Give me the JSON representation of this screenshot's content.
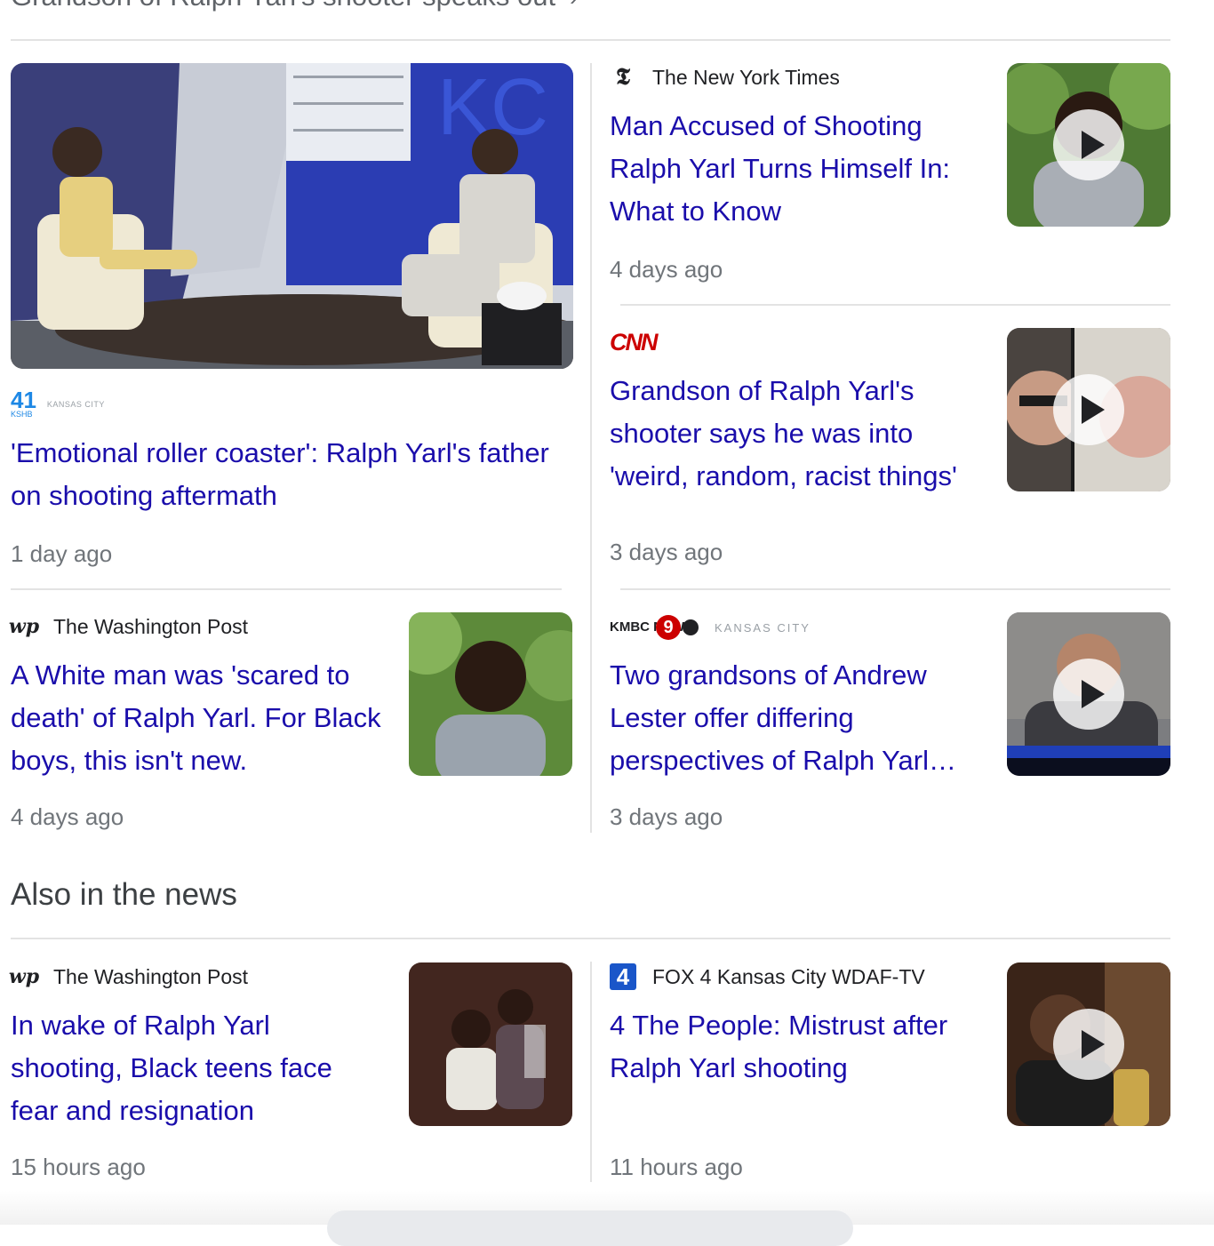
{
  "top_heading": {
    "text": "Grandson of Ralph Yarl's shooter speaks out",
    "chevron": "›"
  },
  "stories": [
    {
      "source_logo_text": "41",
      "source_logo_sub": "KSHB",
      "source_logo_city": "KANSAS CITY",
      "title": "'Emotional roller coaster': Ralph Yarl's father on shooting aftermath",
      "time": "1 day ago"
    },
    {
      "source": "The New York Times",
      "source_logo_text": "𝕿",
      "title": "Man Accused of Shooting Ralph Yarl Turns Himself In: What to Know",
      "time": "4 days ago"
    },
    {
      "source_logo_text": "CNN",
      "title": "Grandson of Ralph Yarl's shooter says he was into 'weird, random, racist things'",
      "time": "3 days ago"
    },
    {
      "source": "The Washington Post",
      "source_logo_text": "wp",
      "title": "A White man was 'scared to death' of Ralph Yarl. For Black boys, this isn't new.",
      "time": "4 days ago"
    },
    {
      "source_logo_text": "KMBC NEWS",
      "source_logo_badge": "9",
      "source_logo_city": "KANSAS CITY",
      "title": "Two grandsons of Andrew Lester offer differing perspectives of Ralph Yarl…",
      "time": "3 days ago"
    }
  ],
  "also_heading": "Also in the news",
  "also_stories": [
    {
      "source": "The Washington Post",
      "source_logo_text": "wp",
      "title": "In wake of Ralph Yarl shooting, Black teens face fear and resignation",
      "time": "15 hours ago"
    },
    {
      "source": "FOX 4 Kansas City WDAF-TV",
      "source_logo_text": "4",
      "title": "4 The People: Mistrust after Ralph Yarl shooting",
      "time": "11 hours ago"
    }
  ],
  "colors": {
    "link": "#1a0dab",
    "meta": "#70757a",
    "divider": "#e3e3e3",
    "cnn": "#cc0000",
    "fox4": "#1a56c9"
  }
}
